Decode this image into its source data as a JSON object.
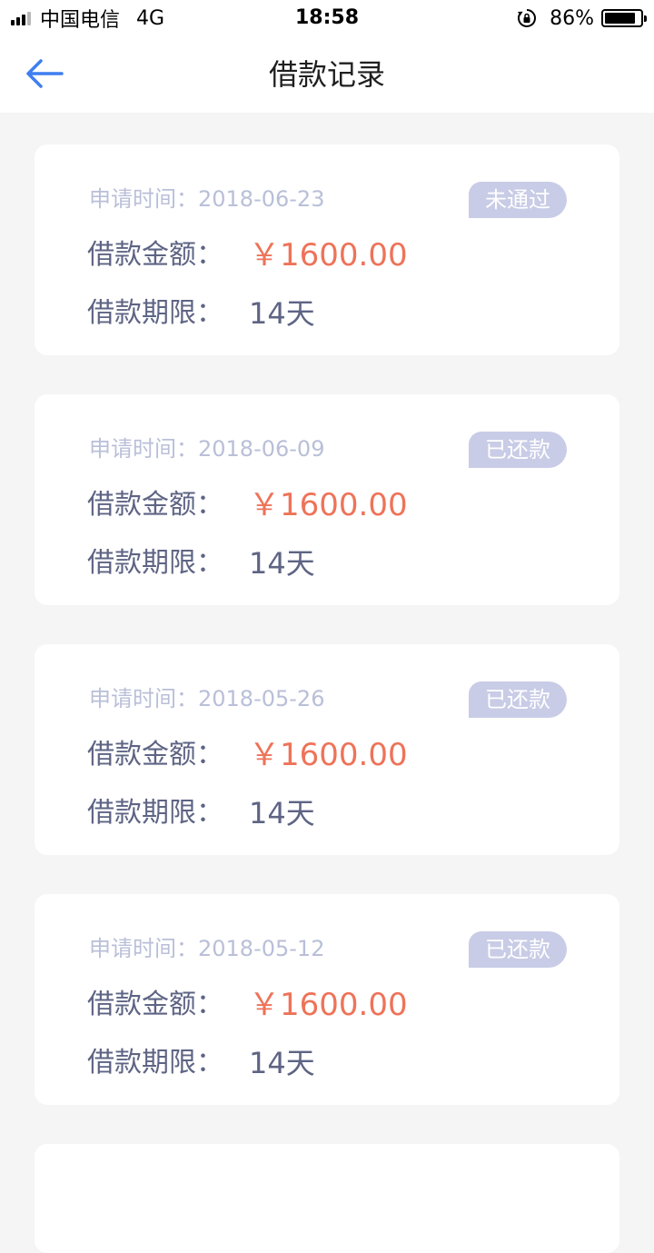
{
  "status_bar": {
    "carrier": "中国电信",
    "network": "4G",
    "time": "18:58",
    "battery": "86%",
    "battery_level": 0.86
  },
  "nav": {
    "title": "借款记录",
    "back_icon": "arrow-left-icon",
    "accent": "#3d7ff0"
  },
  "records": [
    {
      "date_label": "申请时间：2018-06-23",
      "status": "未通过",
      "amount_label": "借款金额：",
      "amount": "￥1600.00",
      "term_label": "借款期限：",
      "term": "14天"
    },
    {
      "date_label": "申请时间：2018-06-09",
      "status": "已还款",
      "amount_label": "借款金额：",
      "amount": "￥1600.00",
      "term_label": "借款期限：",
      "term": "14天"
    },
    {
      "date_label": "申请时间：2018-05-26",
      "status": "已还款",
      "amount_label": "借款金额：",
      "amount": "￥1600.00",
      "term_label": "借款期限：",
      "term": "14天"
    },
    {
      "date_label": "申请时间：2018-05-12",
      "status": "已还款",
      "amount_label": "借款金额：",
      "amount": "￥1600.00",
      "term_label": "借款期限：",
      "term": "14天"
    }
  ],
  "colors": {
    "amount": "#ee7359",
    "badge_bg": "#c9cce6",
    "date_text": "#b9bfd8",
    "label_text": "#5e6484"
  }
}
